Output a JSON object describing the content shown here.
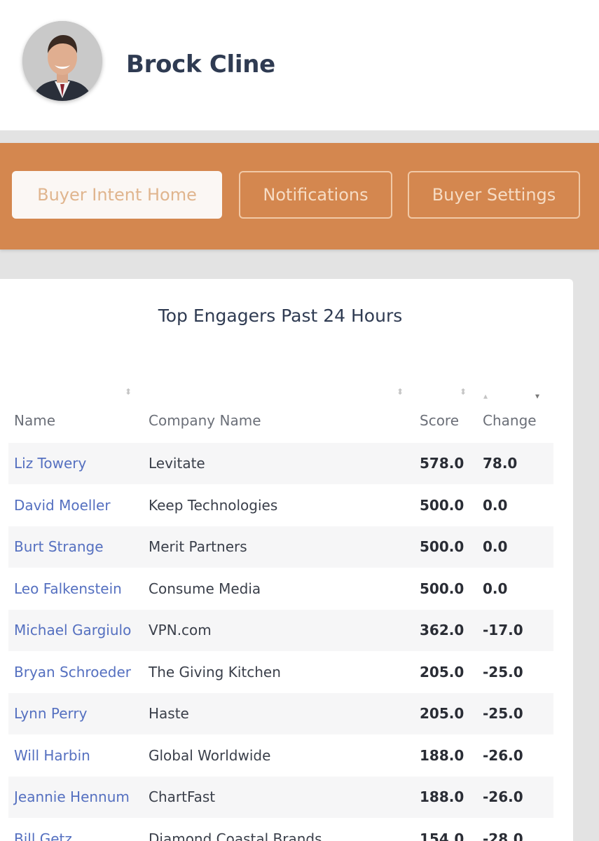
{
  "profile": {
    "name": "Brock Cline"
  },
  "nav": {
    "buttons": [
      {
        "label": "Buyer Intent Home",
        "active": true
      },
      {
        "label": "Notifications",
        "active": false
      },
      {
        "label": "Buyer Settings",
        "active": false
      }
    ]
  },
  "card": {
    "title": "Top Engagers Past 24 Hours",
    "columns": [
      "Name",
      "Company Name",
      "Score",
      "Change"
    ],
    "rows": [
      {
        "name": "Liz Towery",
        "company": "Levitate",
        "score": "578.0",
        "change": "78.0"
      },
      {
        "name": "David Moeller",
        "company": "Keep Technologies",
        "score": "500.0",
        "change": "0.0"
      },
      {
        "name": "Burt Strange",
        "company": "Merit Partners",
        "score": "500.0",
        "change": "0.0"
      },
      {
        "name": "Leo Falkenstein",
        "company": "Consume Media",
        "score": "500.0",
        "change": "0.0"
      },
      {
        "name": "Michael Gargiulo",
        "company": "VPN.com",
        "score": "362.0",
        "change": "-17.0"
      },
      {
        "name": "Bryan Schroeder",
        "company": "The Giving Kitchen",
        "score": "205.0",
        "change": "-25.0"
      },
      {
        "name": "Lynn Perry",
        "company": "Haste",
        "score": "205.0",
        "change": "-25.0"
      },
      {
        "name": "Will Harbin",
        "company": "Global Worldwide",
        "score": "188.0",
        "change": "-26.0"
      },
      {
        "name": "Jeannie Hennum",
        "company": "ChartFast",
        "score": "188.0",
        "change": "-26.0"
      },
      {
        "name": "Bill Getz",
        "company": "Diamond Coastal Brands",
        "score": "154.0",
        "change": "-28.0"
      }
    ]
  },
  "colors": {
    "nav_background": "#d4874f",
    "link": "#5570c0",
    "heading": "#2f3b52"
  }
}
